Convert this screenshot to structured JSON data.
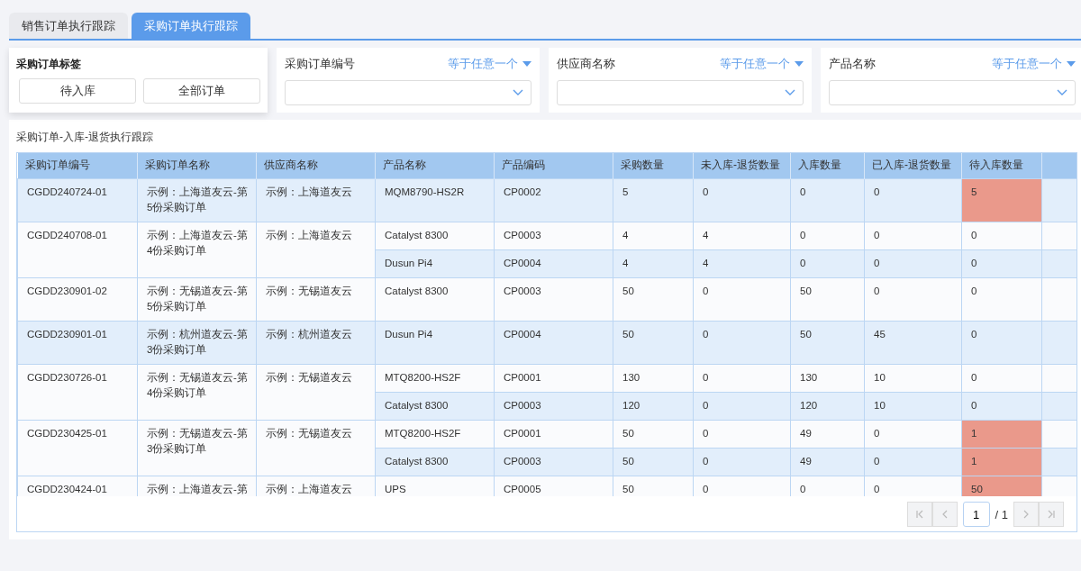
{
  "tabs": [
    {
      "label": "销售订单执行跟踪",
      "selected": false
    },
    {
      "label": "采购订单执行跟踪",
      "selected": true
    }
  ],
  "tag_filter": {
    "label": "采购订单标签",
    "buttons": [
      "待入库",
      "全部订单"
    ]
  },
  "filters": [
    {
      "label": "采购订单编号",
      "operator": "等于任意一个"
    },
    {
      "label": "供应商名称",
      "operator": "等于任意一个"
    },
    {
      "label": "产品名称",
      "operator": "等于任意一个"
    }
  ],
  "table": {
    "title": "采购订单-入库-退货执行跟踪",
    "columns": [
      "采购订单编号",
      "采购订单名称",
      "供应商名称",
      "产品名称",
      "产品编码",
      "采购数量",
      "未入库-退货数量",
      "入库数量",
      "已入库-退货数量",
      "待入库数量"
    ],
    "orders": [
      {
        "number": "CGDD240724-01",
        "name": "示例：上海道友云-第5份采购订单",
        "supplier": "示例：上海道友云",
        "items": [
          {
            "product": "MQM8790-HS2R",
            "code": "CP0002",
            "qty": "5",
            "unreceived_return": "0",
            "received": "0",
            "received_return": "0",
            "pending": "5",
            "alert": true
          }
        ]
      },
      {
        "number": "CGDD240708-01",
        "name": "示例：上海道友云-第4份采购订单",
        "supplier": "示例：上海道友云",
        "items": [
          {
            "product": "Catalyst 8300",
            "code": "CP0003",
            "qty": "4",
            "unreceived_return": "4",
            "received": "0",
            "received_return": "0",
            "pending": "0",
            "alert": false
          },
          {
            "product": "Dusun Pi4",
            "code": "CP0004",
            "qty": "4",
            "unreceived_return": "4",
            "received": "0",
            "received_return": "0",
            "pending": "0",
            "alert": false
          }
        ]
      },
      {
        "number": "CGDD230901-02",
        "name": "示例：无锡道友云-第5份采购订单",
        "supplier": "示例：无锡道友云",
        "items": [
          {
            "product": "Catalyst 8300",
            "code": "CP0003",
            "qty": "50",
            "unreceived_return": "0",
            "received": "50",
            "received_return": "0",
            "pending": "0",
            "alert": false
          }
        ]
      },
      {
        "number": "CGDD230901-01",
        "name": "示例：杭州道友云-第3份采购订单",
        "supplier": "示例：杭州道友云",
        "items": [
          {
            "product": "Dusun Pi4",
            "code": "CP0004",
            "qty": "50",
            "unreceived_return": "0",
            "received": "50",
            "received_return": "45",
            "pending": "0",
            "alert": false
          }
        ]
      },
      {
        "number": "CGDD230726-01",
        "name": "示例：无锡道友云-第4份采购订单",
        "supplier": "示例：无锡道友云",
        "items": [
          {
            "product": "MTQ8200-HS2F",
            "code": "CP0001",
            "qty": "130",
            "unreceived_return": "0",
            "received": "130",
            "received_return": "10",
            "pending": "0",
            "alert": false
          },
          {
            "product": "Catalyst 8300",
            "code": "CP0003",
            "qty": "120",
            "unreceived_return": "0",
            "received": "120",
            "received_return": "10",
            "pending": "0",
            "alert": false
          }
        ]
      },
      {
        "number": "CGDD230425-01",
        "name": "示例：无锡道友云-第3份采购订单",
        "supplier": "示例：无锡道友云",
        "items": [
          {
            "product": "MTQ8200-HS2F",
            "code": "CP0001",
            "qty": "50",
            "unreceived_return": "0",
            "received": "49",
            "received_return": "0",
            "pending": "1",
            "alert": true
          },
          {
            "product": "Catalyst 8300",
            "code": "CP0003",
            "qty": "50",
            "unreceived_return": "0",
            "received": "49",
            "received_return": "0",
            "pending": "1",
            "alert": true
          }
        ]
      },
      {
        "number": "CGDD230424-01",
        "name": "示例：上海道友云-第",
        "supplier": "示例：上海道友云",
        "items": [
          {
            "product": "UPS",
            "code": "CP0005",
            "qty": "50",
            "unreceived_return": "0",
            "received": "0",
            "received_return": "0",
            "pending": "50",
            "alert": true
          }
        ]
      }
    ]
  },
  "pager": {
    "page": "1",
    "total": "/ 1",
    "disabled": true
  }
}
